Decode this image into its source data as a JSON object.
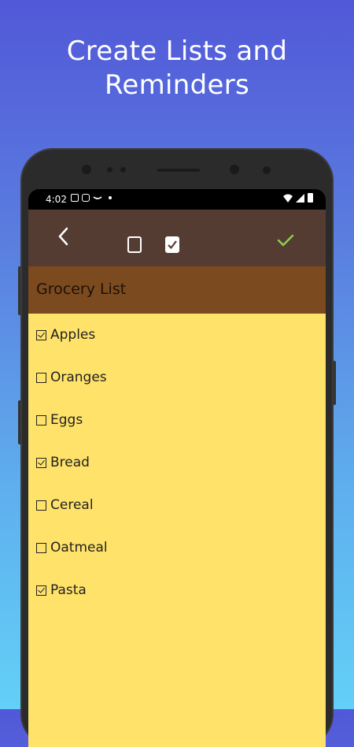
{
  "headline": {
    "line1": "Create Lists and",
    "line2": "Reminders"
  },
  "status_bar": {
    "time": "4:02"
  },
  "toolbar": {
    "back_icon": "chevron-left-icon",
    "unchecked_icon": "checkbox-unchecked-icon",
    "checked_icon": "checkbox-checked-icon",
    "confirm_icon": "checkmark-icon",
    "confirm_color": "#8fd14f"
  },
  "list": {
    "title": "Grocery List",
    "items": [
      {
        "label": "Apples",
        "checked": true
      },
      {
        "label": "Oranges",
        "checked": false
      },
      {
        "label": "Eggs",
        "checked": false
      },
      {
        "label": "Bread",
        "checked": true
      },
      {
        "label": "Cereal",
        "checked": false
      },
      {
        "label": "Oatmeal",
        "checked": false
      },
      {
        "label": "Pasta",
        "checked": true
      }
    ]
  },
  "colors": {
    "toolbar": "#553c33",
    "title_bar": "#7b4a1f",
    "note_background": "#ffe26a"
  }
}
